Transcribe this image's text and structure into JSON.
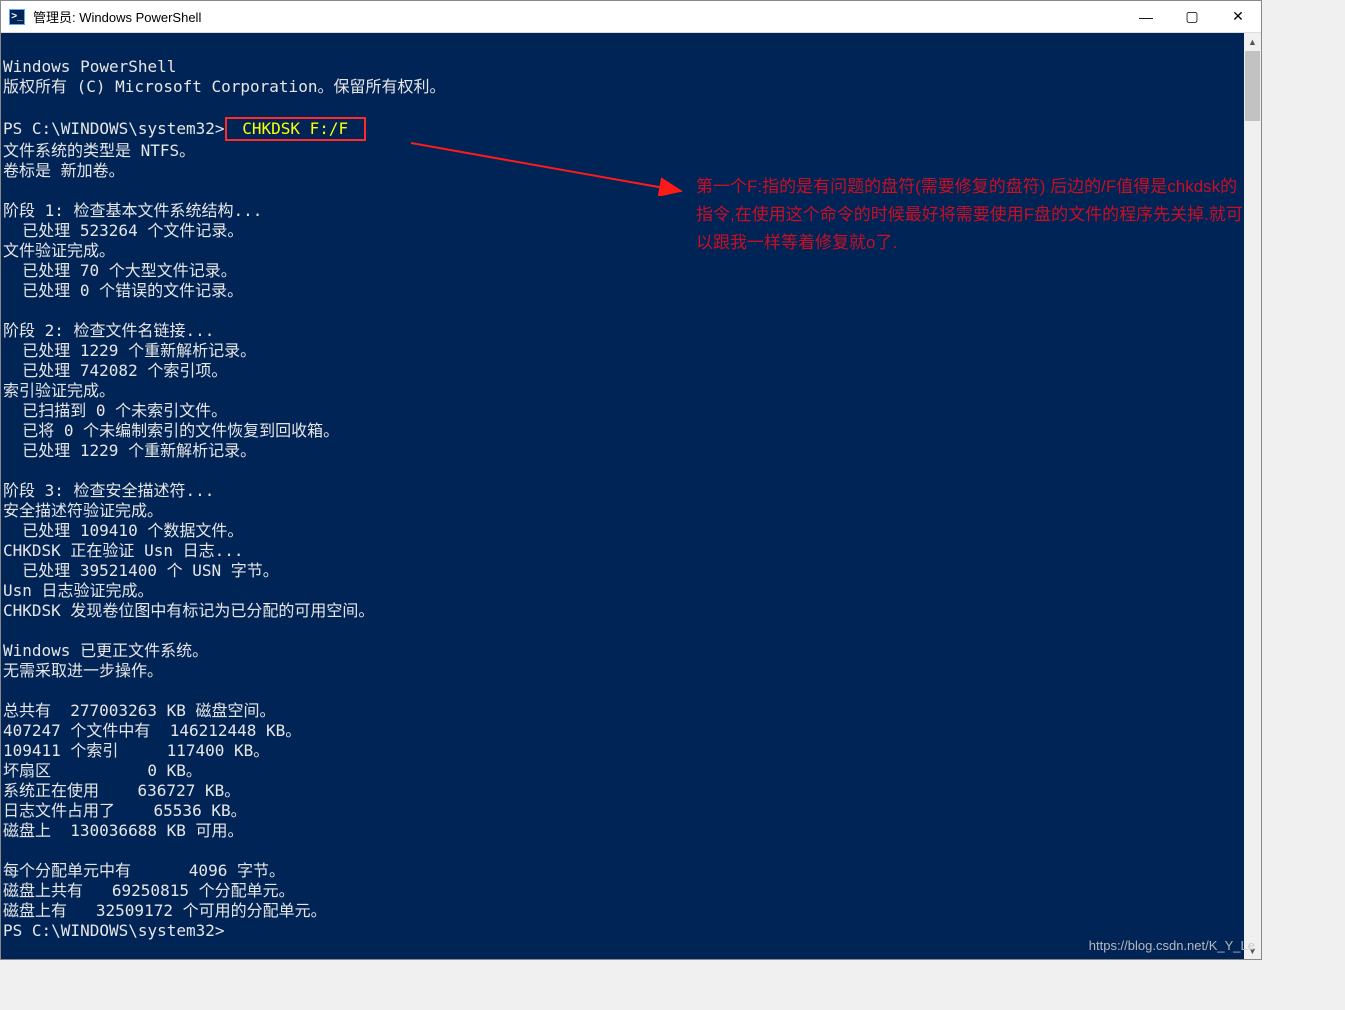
{
  "window": {
    "title": "管理员: Windows PowerShell",
    "icon_glyph": ">_"
  },
  "controls": {
    "min": "—",
    "max": "▢",
    "close": "✕"
  },
  "terminal": {
    "header1": "Windows PowerShell",
    "header2": "版权所有 (C) Microsoft Corporation。保留所有权利。",
    "prompt": "PS C:\\WINDOWS\\system32>",
    "command": " CHKDSK F:/F ",
    "lines": [
      "文件系统的类型是 NTFS。",
      "卷标是 新加卷。",
      "",
      "阶段 1: 检查基本文件系统结构...",
      "  已处理 523264 个文件记录。",
      "文件验证完成。",
      "  已处理 70 个大型文件记录。",
      "  已处理 0 个错误的文件记录。",
      "",
      "阶段 2: 检查文件名链接...",
      "  已处理 1229 个重新解析记录。",
      "  已处理 742082 个索引项。",
      "索引验证完成。",
      "  已扫描到 0 个未索引文件。",
      "  已将 0 个未编制索引的文件恢复到回收箱。",
      "  已处理 1229 个重新解析记录。",
      "",
      "阶段 3: 检查安全描述符...",
      "安全描述符验证完成。",
      "  已处理 109410 个数据文件。",
      "CHKDSK 正在验证 Usn 日志...",
      "  已处理 39521400 个 USN 字节。",
      "Usn 日志验证完成。",
      "CHKDSK 发现卷位图中有标记为已分配的可用空间。",
      "",
      "Windows 已更正文件系统。",
      "无需采取进一步操作。",
      "",
      "总共有  277003263 KB 磁盘空间。",
      "407247 个文件中有  146212448 KB。",
      "109411 个索引     117400 KB。",
      "坏扇区          0 KB。",
      "系统正在使用    636727 KB。",
      "日志文件占用了    65536 KB。",
      "磁盘上  130036688 KB 可用。",
      "",
      "每个分配单元中有      4096 字节。",
      "磁盘上共有   69250815 个分配单元。",
      "磁盘上有   32509172 个可用的分配单元。"
    ],
    "prompt_end": "PS C:\\WINDOWS\\system32>"
  },
  "annotation": {
    "text": "第一个F:指的是有问题的盘符(需要修复的盘符) 后边的/F值得是chkdsk的指令,在使用这个命令的时候最好将需要使用F盘的文件的程序先关掉.就可以跟我一样等着修复就o了."
  },
  "watermark": "https://blog.csdn.net/K_Y_Le",
  "scrollbar": {
    "arrow_up": "▲",
    "arrow_down": "▼"
  }
}
